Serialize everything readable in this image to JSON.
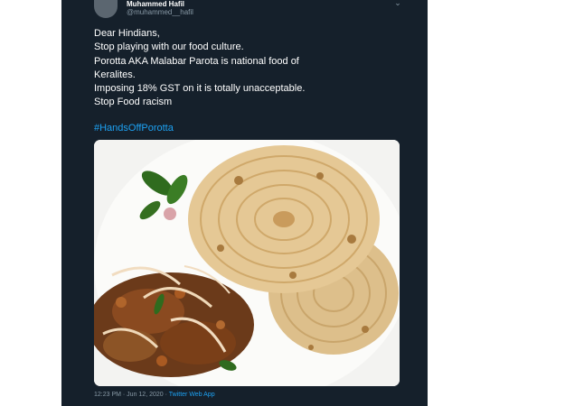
{
  "author": {
    "name": "Muhammed Hafil",
    "handle": "@muhammed__hafil"
  },
  "tweet": {
    "lines": [
      "Dear Hindians,",
      "Stop playing with our food culture.",
      "Porotta AKA Malabar Parota is national food of",
      "Keralites.",
      "Imposing 18% GST on it is totally unacceptable.",
      "Stop Food racism"
    ],
    "hashtag": "#HandsOffPorotta",
    "time": "12:23 PM · Jun 12, 2020 ·",
    "source": "Twitter Web App"
  },
  "icons": {
    "menu": "chevron-down-icon"
  },
  "colors": {
    "background": "#15202b",
    "link": "#1da1f2",
    "secondary_text": "#8899a6"
  }
}
